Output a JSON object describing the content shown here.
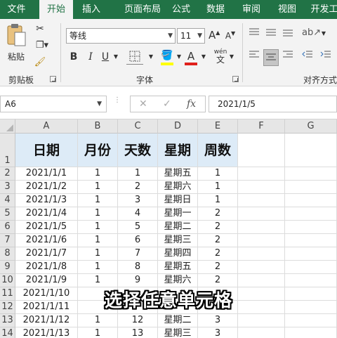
{
  "tabs": [
    "文件",
    "开始",
    "插入",
    "页面布局",
    "公式",
    "数据",
    "审阅",
    "视图",
    "开发工"
  ],
  "ribbon": {
    "clipboard": {
      "label": "剪贴板",
      "paste": "粘贴"
    },
    "font": {
      "label": "字体",
      "name": "等线",
      "size": "11",
      "grow": "A",
      "shrink": "A",
      "bold": "B",
      "italic": "I",
      "underline": "U",
      "font_color": "A",
      "phonetic": "wén",
      "phonetic_sub": "文"
    },
    "align": {
      "label": "对齐方式"
    }
  },
  "formula_bar": {
    "cell_ref": "A6",
    "cancel": "✕",
    "enter": "✓",
    "fx": "fx",
    "value": "2021/1/5"
  },
  "columns": [
    "A",
    "B",
    "C",
    "D",
    "E",
    "F",
    "G"
  ],
  "header_row": {
    "row": "1",
    "cells": [
      "日期",
      "月份",
      "天数",
      "星期",
      "周数"
    ]
  },
  "rows": [
    {
      "row": "2",
      "cells": [
        "2021/1/1",
        "1",
        "1",
        "星期五",
        "1"
      ]
    },
    {
      "row": "3",
      "cells": [
        "2021/1/2",
        "1",
        "2",
        "星期六",
        "1"
      ]
    },
    {
      "row": "4",
      "cells": [
        "2021/1/3",
        "1",
        "3",
        "星期日",
        "1"
      ]
    },
    {
      "row": "5",
      "cells": [
        "2021/1/4",
        "1",
        "4",
        "星期一",
        "2"
      ]
    },
    {
      "row": "6",
      "cells": [
        "2021/1/5",
        "1",
        "5",
        "星期二",
        "2"
      ]
    },
    {
      "row": "7",
      "cells": [
        "2021/1/6",
        "1",
        "6",
        "星期三",
        "2"
      ]
    },
    {
      "row": "8",
      "cells": [
        "2021/1/7",
        "1",
        "7",
        "星期四",
        "2"
      ]
    },
    {
      "row": "9",
      "cells": [
        "2021/1/8",
        "1",
        "8",
        "星期五",
        "2"
      ]
    },
    {
      "row": "10",
      "cells": [
        "2021/1/9",
        "1",
        "9",
        "星期六",
        "2"
      ]
    },
    {
      "row": "11",
      "cells": [
        "2021/1/10",
        "",
        "",
        "",
        ""
      ]
    },
    {
      "row": "12",
      "cells": [
        "2021/1/11",
        "",
        "",
        "",
        ""
      ]
    },
    {
      "row": "13",
      "cells": [
        "2021/1/12",
        "1",
        "12",
        "星期二",
        "3"
      ]
    },
    {
      "row": "14",
      "cells": [
        "2021/1/13",
        "1",
        "13",
        "星期三",
        "3"
      ]
    }
  ],
  "caption": "选择任意单元格",
  "colors": {
    "brand": "#217346",
    "header_fill": "#ddebf7"
  }
}
